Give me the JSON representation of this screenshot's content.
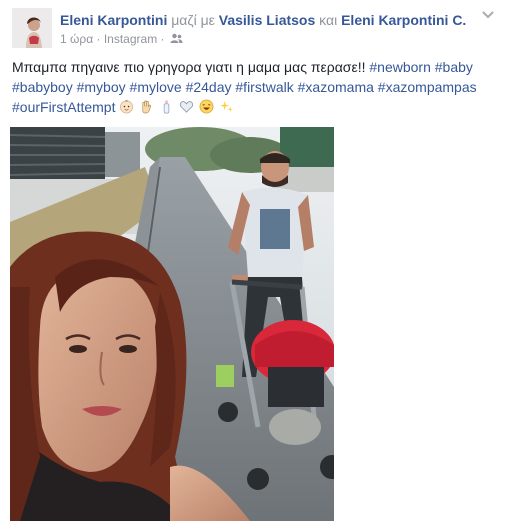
{
  "post": {
    "author": "Eleni Karpontini",
    "with_word": "μαζί με",
    "tagged_1": "Vasilis Liatsos",
    "and_word": "και",
    "tagged_2": "Eleni Karpontini C.",
    "time": "1 ώρα",
    "separator": "·",
    "source": "Instagram",
    "privacy_icon": "friends-icon",
    "caption_text": "Μπαμπα πηγαινε πιο γρηγορα γιατι η μαμα μας περασε!!",
    "hashtags_line1": [
      "#newborn",
      "#baby"
    ],
    "hashtags_line2": [
      "#babyboy",
      "#myboy",
      "#mylove",
      "#24day",
      "#firstwalk",
      "#xazomama",
      "#xazompampas"
    ],
    "hashtags_line3": [
      "#ourFirstAttempt"
    ],
    "emojis": [
      "baby-face-emoji",
      "hand-emoji",
      "baby-bottle-emoji",
      "heart-emoji",
      "laughing-face-emoji",
      "sparkles-emoji"
    ],
    "menu_icon": "chevron-down-icon",
    "photo_description_icon": "photo"
  },
  "colors": {
    "link": "#365899",
    "meta": "#90949c",
    "text": "#1d2129"
  }
}
